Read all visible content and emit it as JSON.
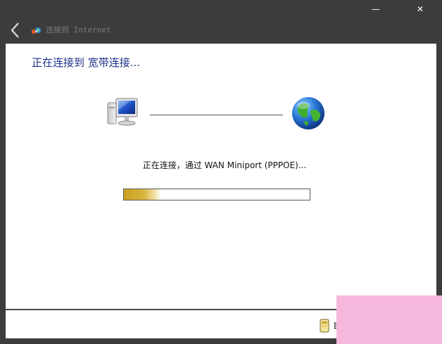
{
  "window": {
    "minimize_glyph": "—",
    "close_glyph": "✕"
  },
  "titlebar": {
    "back_icon": "chevron-left-icon",
    "app_icon": "network-connection-icon",
    "title": "连接到 Internet"
  },
  "main": {
    "heading": "正在连接到 宽带连接...",
    "status": "正在连接，通过 WAN Miniport (PPPOE)...",
    "computer_icon": "computer-icon",
    "globe_icon": "globe-icon",
    "progress_fraction": 0.2
  },
  "footer": {
    "cancel_label": "取",
    "cancel_icon": "shield-icon"
  },
  "colors": {
    "heading": "#1e3287",
    "progress_fill": "#c9a11e",
    "chrome": "#3c3c3c",
    "overlay": "#f5b8dc"
  }
}
